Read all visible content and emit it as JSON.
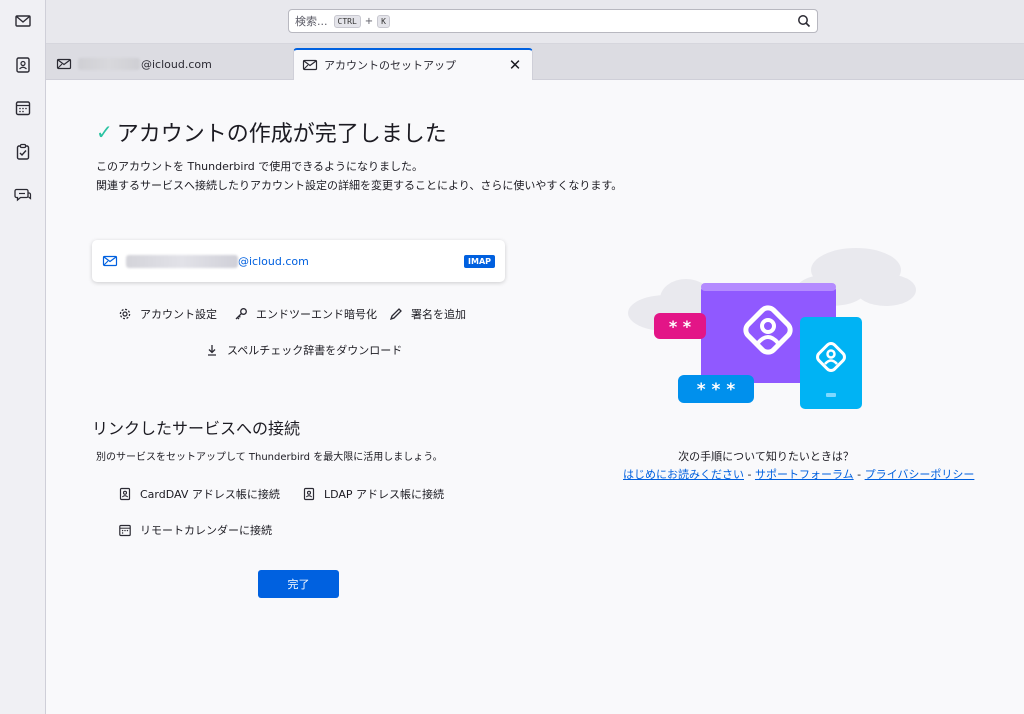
{
  "spaces": [
    {
      "name": "mail",
      "icon": "mail-icon"
    },
    {
      "name": "address-book",
      "icon": "address-book-icon"
    },
    {
      "name": "calendar",
      "icon": "calendar-icon"
    },
    {
      "name": "tasks",
      "icon": "tasks-icon"
    },
    {
      "name": "chat",
      "icon": "chat-icon"
    }
  ],
  "search": {
    "placeholder": "検索...",
    "key1": "CTRL",
    "plus": "+",
    "key2": "K"
  },
  "tabs": [
    {
      "label": "@icloud.com",
      "icon": "mail-account-icon"
    },
    {
      "label": "アカウントのセットアップ",
      "icon": "mail-account-icon",
      "active": true
    }
  ],
  "main": {
    "title": "アカウントの作成が完了しました",
    "check": "✓",
    "line1": "このアカウントを Thunderbird で使用できるようになりました。",
    "line2": "関連するサービスへ接続したりアカウント設定の詳細を変更することにより、さらに使いやすくなります。",
    "account_email": "@icloud.com",
    "account_type": "IMAP",
    "actions": {
      "settings": "アカウント設定",
      "e2e": "エンドツーエンド暗号化",
      "signature": "署名を追加",
      "dictionary": "スペルチェック辞書をダウンロード"
    },
    "services_title": "リンクしたサービスへの接続",
    "services_desc": "別のサービスをセットアップして Thunderbird を最大限に活用しましょう。",
    "services": {
      "carddav": "CardDAV アドレス帳に接続",
      "ldap": "LDAP アドレス帳に接続",
      "calendar": "リモートカレンダーに接続"
    },
    "done": "完了",
    "next_question": "次の手順について知りたいときは？",
    "links": {
      "readme": "はじめにお読みください",
      "sep1": " - ",
      "support": "サポートフォーラム",
      "sep2": " - ",
      "privacy": "プライバシーポリシー"
    }
  },
  "colors": {
    "accent": "#0061e0",
    "check": "#2ac3a2",
    "purple": "#9059ff",
    "cyan": "#00b3f4",
    "pink": "#ff4f5e"
  }
}
